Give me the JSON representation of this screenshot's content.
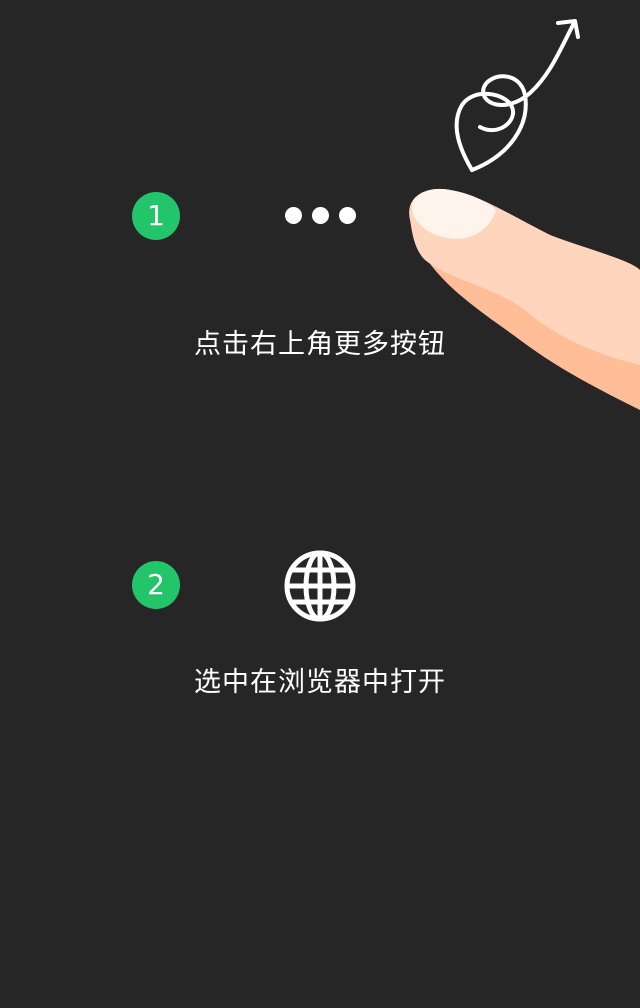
{
  "steps": [
    {
      "number": "1",
      "instruction": "点击右上角更多按钮",
      "icon": "more-dots-icon"
    },
    {
      "number": "2",
      "instruction": "选中在浏览器中打开",
      "icon": "globe-icon"
    }
  ],
  "colors": {
    "background": "#262626",
    "badge": "#22c56a",
    "text": "#ffffff",
    "finger_light": "#ffd6bd",
    "finger_shadow": "#ffbe98"
  },
  "decorations": {
    "swirl_arrow": "swirl-arrow-icon",
    "finger": "pointing-finger-illustration"
  }
}
